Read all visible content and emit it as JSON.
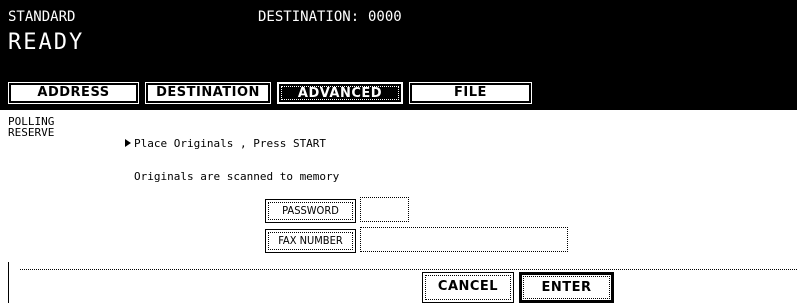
{
  "header": {
    "mode": "STANDARD",
    "destination_label": "DESTINATION:",
    "destination_value": "0000",
    "status": "READY"
  },
  "tabs": [
    {
      "label": "ADDRESS",
      "active": false
    },
    {
      "label": "DESTINATION",
      "active": false
    },
    {
      "label": "ADVANCED",
      "active": true
    },
    {
      "label": "FILE",
      "active": false
    }
  ],
  "content": {
    "mode_line1": "POLLING",
    "mode_line2": "RESERVE",
    "message_line1": "Place Originals , Press START",
    "message_line2": "Originals are scanned to memory"
  },
  "fields": {
    "password_button": "PASSWORD",
    "password_value": "",
    "fax_number_button": "FAX NUMBER",
    "fax_number_value": ""
  },
  "actions": {
    "cancel": "CANCEL",
    "enter": "ENTER"
  }
}
